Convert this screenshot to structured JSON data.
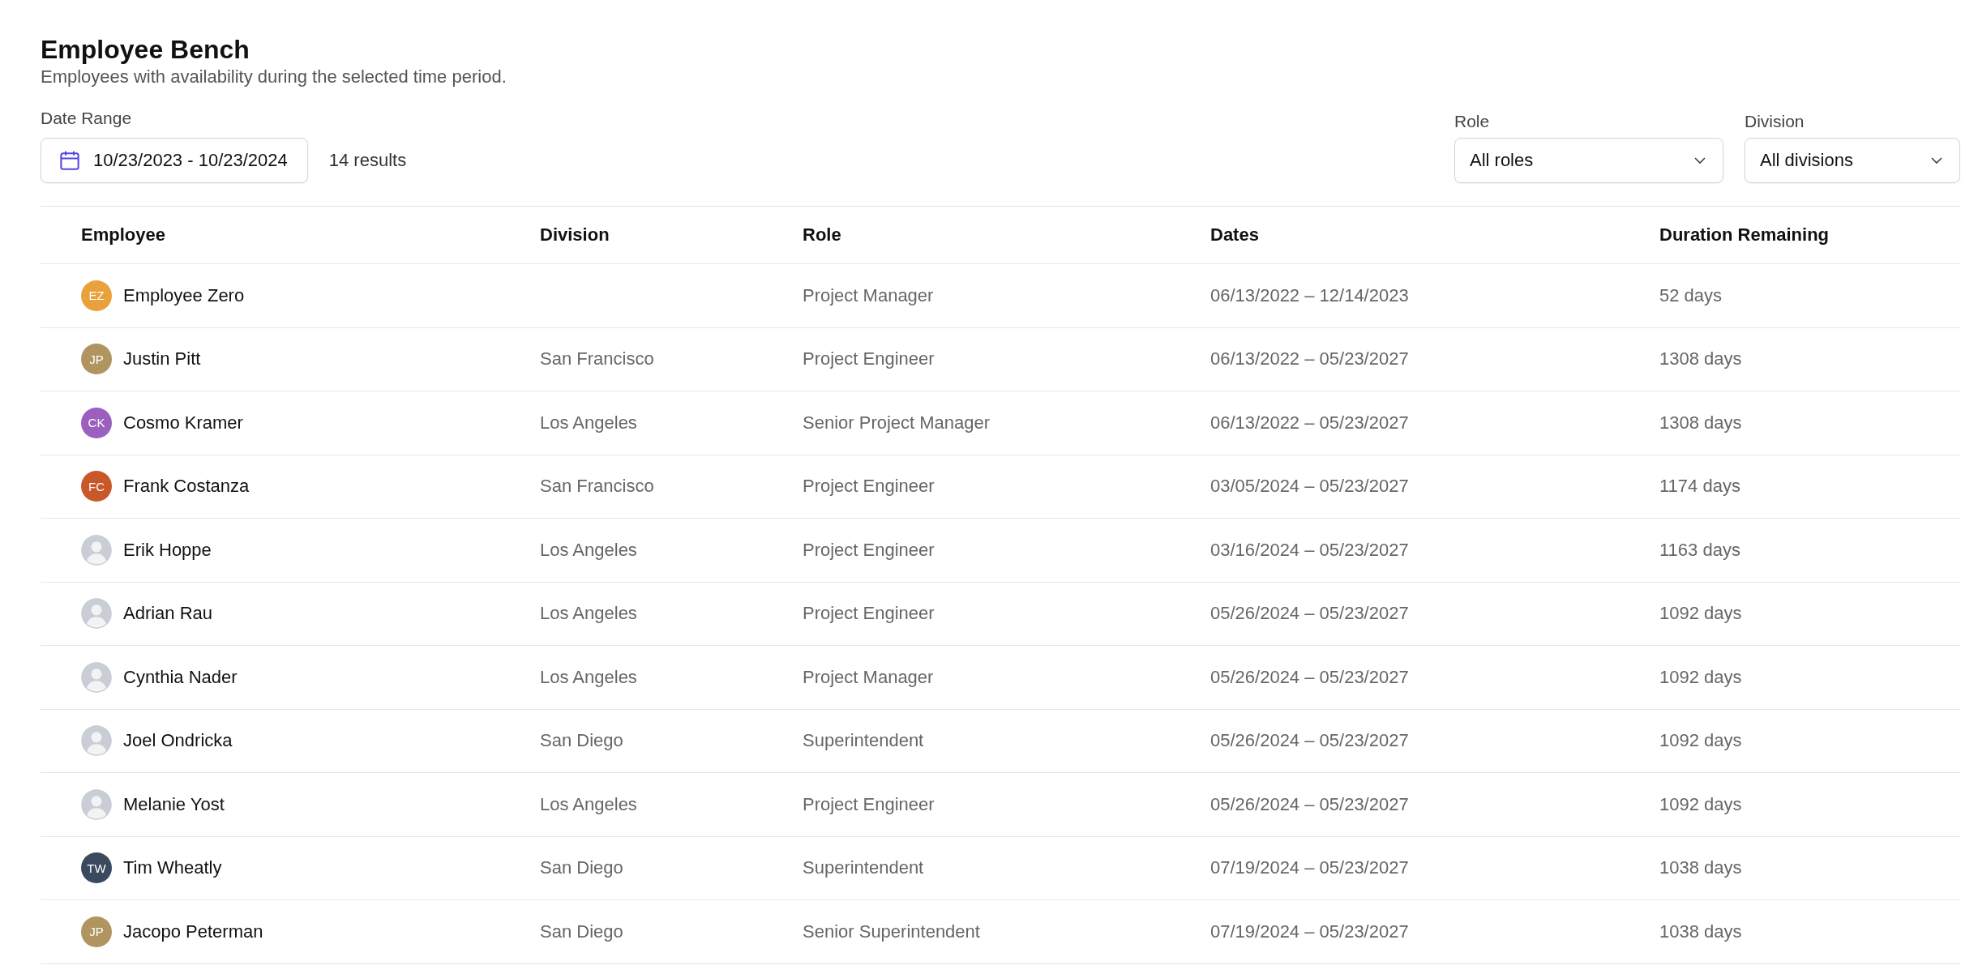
{
  "header": {
    "title": "Employee Bench",
    "subtitle": "Employees with availability during the selected time period."
  },
  "filters": {
    "date_range": {
      "label": "Date Range",
      "value": "10/23/2023 - 10/23/2024"
    },
    "result_count": "14 results",
    "role": {
      "label": "Role",
      "value": "All roles"
    },
    "division": {
      "label": "Division",
      "value": "All divisions"
    }
  },
  "table": {
    "columns": [
      "Employee",
      "Division",
      "Role",
      "Dates",
      "Duration Remaining"
    ],
    "rows": [
      {
        "avatar": {
          "kind": "initials",
          "initials": "EZ",
          "color": "#e9a23b"
        },
        "name": "Employee Zero",
        "role": "Project Manager",
        "dates": "06/13/2022 – 12/14/2023",
        "duration": "52 days"
      },
      {
        "avatar": {
          "kind": "initials",
          "initials": "JP",
          "color": "#b09561"
        },
        "name": "Justin Pitt",
        "division": "San Francisco",
        "role": "Project Engineer",
        "dates": "06/13/2022 – 05/23/2027",
        "duration": "1308 days"
      },
      {
        "avatar": {
          "kind": "initials",
          "initials": "CK",
          "color": "#9b5fc0"
        },
        "name": "Cosmo Kramer",
        "division": "Los Angeles",
        "role": "Senior Project Manager",
        "dates": "06/13/2022 – 05/23/2027",
        "duration": "1308 days"
      },
      {
        "avatar": {
          "kind": "initials",
          "initials": "FC",
          "color": "#c8582a"
        },
        "name": "Frank Costanza",
        "division": "San Francisco",
        "role": "Project Engineer",
        "dates": "03/05/2024 – 05/23/2027",
        "duration": "1174 days"
      },
      {
        "avatar": {
          "kind": "photo"
        },
        "name": "Erik Hoppe",
        "division": "Los Angeles",
        "role": "Project Engineer",
        "dates": "03/16/2024 – 05/23/2027",
        "duration": "1163 days"
      },
      {
        "avatar": {
          "kind": "photo"
        },
        "name": "Adrian Rau",
        "division": "Los Angeles",
        "role": "Project Engineer",
        "dates": "05/26/2024 – 05/23/2027",
        "duration": "1092 days"
      },
      {
        "avatar": {
          "kind": "photo"
        },
        "name": "Cynthia Nader",
        "division": "Los Angeles",
        "role": "Project Manager",
        "dates": "05/26/2024 – 05/23/2027",
        "duration": "1092 days"
      },
      {
        "avatar": {
          "kind": "photo"
        },
        "name": "Joel Ondricka",
        "division": "San Diego",
        "role": "Superintendent",
        "dates": "05/26/2024 – 05/23/2027",
        "duration": "1092 days"
      },
      {
        "avatar": {
          "kind": "photo"
        },
        "name": "Melanie Yost",
        "division": "Los Angeles",
        "role": "Project Engineer",
        "dates": "05/26/2024 – 05/23/2027",
        "duration": "1092 days"
      },
      {
        "avatar": {
          "kind": "initials",
          "initials": "TW",
          "color": "#394a5e"
        },
        "name": "Tim Wheatly",
        "division": "San Diego",
        "role": "Superintendent",
        "dates": "07/19/2024 – 05/23/2027",
        "duration": "1038 days"
      },
      {
        "avatar": {
          "kind": "initials",
          "initials": "JP",
          "color": "#b09561"
        },
        "name": "Jacopo Peterman",
        "division": "San Diego",
        "role": "Senior Superintendent",
        "dates": "07/19/2024 – 05/23/2027",
        "duration": "1038 days"
      }
    ]
  }
}
